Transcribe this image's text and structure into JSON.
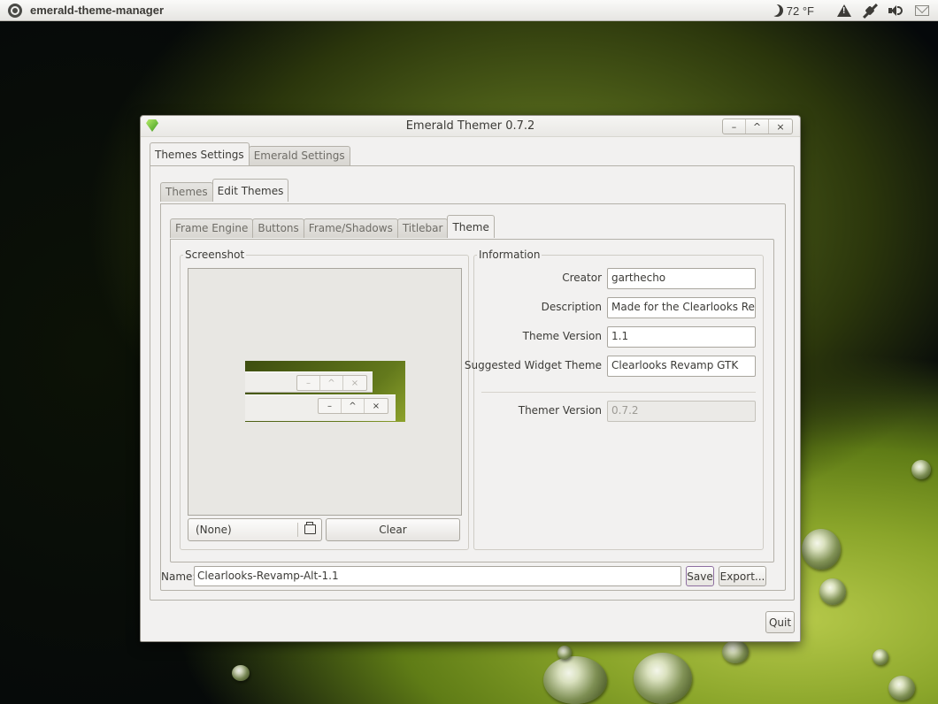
{
  "panel": {
    "app_name": "emerald-theme-manager",
    "weather": "72 °F"
  },
  "window": {
    "title": "Emerald Themer 0.7.2",
    "controls": {
      "minimize": "–",
      "maximize": "^",
      "close": "×"
    }
  },
  "main_tabs": [
    {
      "label": "Themes Settings",
      "active": true
    },
    {
      "label": "Emerald Settings",
      "active": false
    }
  ],
  "sub_tabs": [
    {
      "label": "Themes",
      "active": false
    },
    {
      "label": "Edit Themes",
      "active": true
    }
  ],
  "edit_tabs": [
    {
      "label": "Frame Engine",
      "active": false
    },
    {
      "label": "Buttons",
      "active": false
    },
    {
      "label": "Frame/Shadows",
      "active": false
    },
    {
      "label": "Titlebar",
      "active": false
    },
    {
      "label": "Theme",
      "active": true
    }
  ],
  "screenshot": {
    "label": "Screenshot",
    "file_value": "(None)",
    "clear_label": "Clear",
    "preview_controls": {
      "minimize": "–",
      "maximize": "^",
      "close": "×"
    }
  },
  "information": {
    "label": "Information",
    "fields": [
      {
        "label": "Creator",
        "value": "garthecho"
      },
      {
        "label": "Description",
        "value": "Made for the Clearlooks Revamp"
      },
      {
        "label": "Theme Version",
        "value": "1.1"
      },
      {
        "label": "Suggested Widget Theme",
        "value": "Clearlooks Revamp GTK"
      }
    ],
    "themer_version_label": "Themer Version",
    "themer_version_value": "0.7.2"
  },
  "name_row": {
    "label": "Name:",
    "value": "Clearlooks-Revamp-Alt-1.1",
    "save_label": "Save",
    "export_label": "Export..."
  },
  "quit_label": "Quit",
  "colors": {
    "window_bg": "#f2f1f0",
    "text": "#3c3b37",
    "accent_green": "#63791c"
  }
}
